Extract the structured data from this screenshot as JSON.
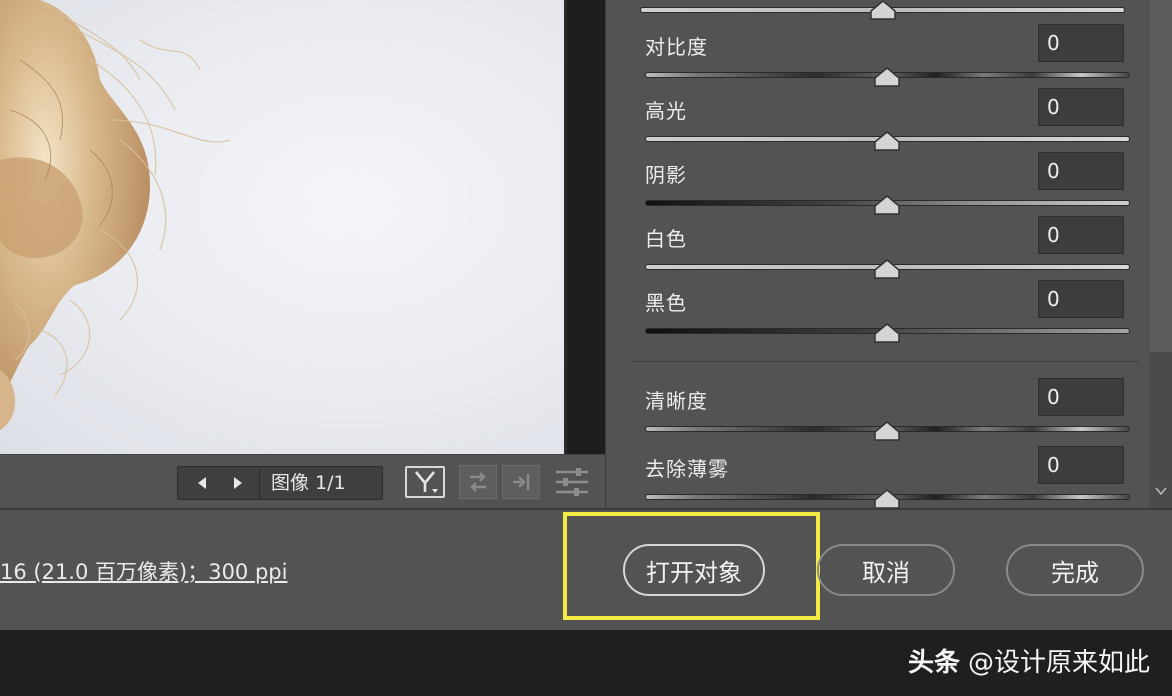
{
  "navigator": {
    "label": "图像 1/1"
  },
  "adjustments": [
    {
      "label": "对比度",
      "value": "0",
      "track": "contrast"
    },
    {
      "label": "高光",
      "value": "0",
      "track": "grey"
    },
    {
      "label": "阴影",
      "value": "0",
      "track": "dark"
    },
    {
      "label": "白色",
      "value": "0",
      "track": "grey"
    },
    {
      "label": "黑色",
      "value": "0",
      "track": "dark2"
    },
    {
      "label": "清晰度",
      "value": "0",
      "track": "contrast"
    },
    {
      "label": "去除薄雾",
      "value": "0",
      "track": "contrast"
    }
  ],
  "footer": {
    "file_info": "16 (21.0 百万像素)；300 ppi",
    "open_object": "打开对象",
    "cancel": "取消",
    "done": "完成"
  },
  "watermark": {
    "brand": "头条",
    "handle": "@设计原来如此"
  },
  "colors": {
    "highlight": "#f4ec45",
    "panel": "#535353",
    "field": "#3d3d3d"
  },
  "icons": [
    "prev-icon",
    "next-icon",
    "y-view-icon",
    "swap-icon",
    "copy-settings-icon",
    "preferences-icon",
    "scroll-down-icon"
  ]
}
